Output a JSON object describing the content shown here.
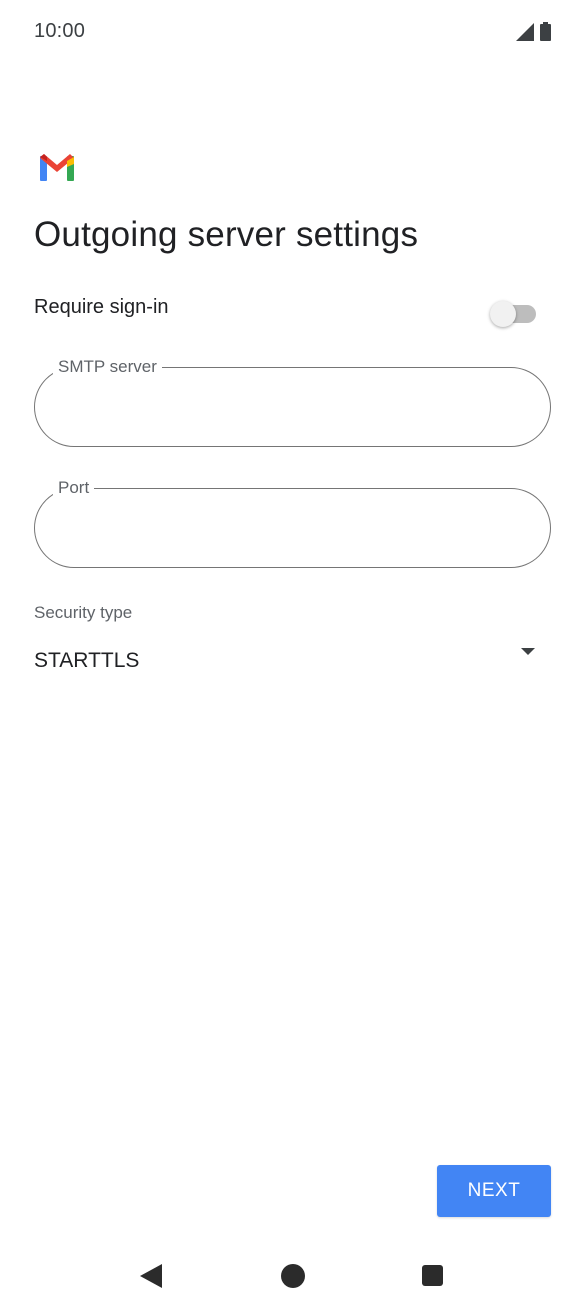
{
  "status_bar": {
    "time": "10:00",
    "icons": [
      "cellular-signal-icon",
      "battery-icon"
    ]
  },
  "app": {
    "logo": "gmail-logo",
    "brand_colors": {
      "blue": "#4285F4",
      "red": "#EA4335",
      "yellow": "#FBBC04",
      "green": "#34A853"
    }
  },
  "page": {
    "title": "Outgoing server settings"
  },
  "require_signin": {
    "label": "Require sign-in",
    "enabled": false
  },
  "smtp_server": {
    "label": "SMTP server",
    "value": ""
  },
  "port": {
    "label": "Port",
    "value": ""
  },
  "security_type": {
    "label": "Security type",
    "selected": "STARTTLS"
  },
  "actions": {
    "next_label": "NEXT",
    "next_color": "#4285F4"
  },
  "nav_bar": {
    "buttons": [
      "back-icon",
      "home-icon",
      "recents-icon"
    ]
  }
}
